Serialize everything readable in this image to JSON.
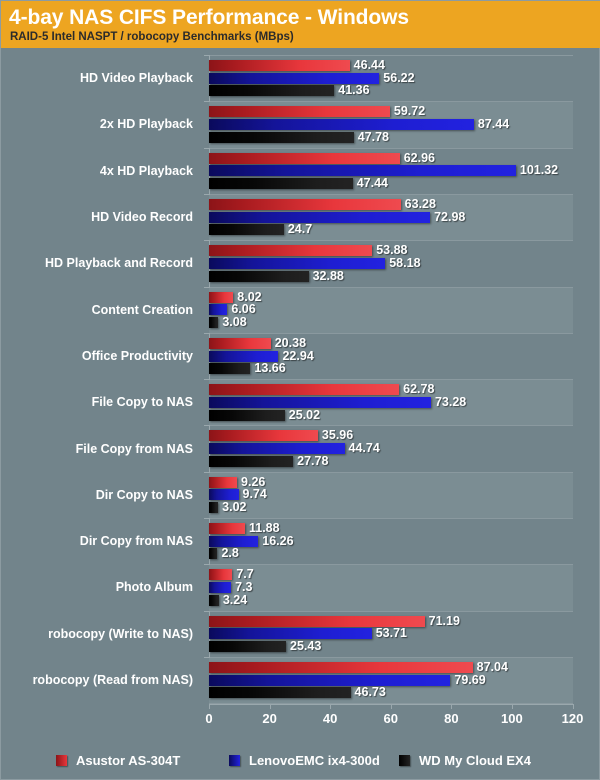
{
  "header": {
    "title": "4-bay NAS CIFS Performance - Windows",
    "subtitle": "RAID-5 Intel NASPT / robocopy Benchmarks (MBps)",
    "background_color": "#eda521",
    "title_color": "#ffffff",
    "subtitle_color": "#2b2b2b"
  },
  "canvas": {
    "background_color": "#72848b",
    "band_color": "#7b8d93"
  },
  "chart_data": {
    "type": "bar",
    "orientation": "horizontal",
    "title": "4-bay NAS CIFS Performance - Windows",
    "subtitle": "RAID-5 Intel NASPT / robocopy Benchmarks (MBps)",
    "xlabel": "",
    "ylabel": "",
    "xlim": [
      0,
      120
    ],
    "xticks": [
      0,
      20,
      40,
      60,
      80,
      100,
      120
    ],
    "grid": true,
    "legend_position": "bottom",
    "categories": [
      "HD Video Playback",
      "2x HD Playback",
      "4x HD Playback",
      "HD Video Record",
      "HD Playback and Record",
      "Content Creation",
      "Office Productivity",
      "File Copy to NAS",
      "File Copy from NAS",
      "Dir Copy to NAS",
      "Dir Copy from NAS",
      "Photo Album",
      "robocopy (Write to NAS)",
      "robocopy (Read from NAS)"
    ],
    "series": [
      {
        "name": "Asustor AS-304T",
        "color": "#d42a2f",
        "values": [
          46.44,
          59.72,
          62.96,
          63.28,
          53.88,
          8.02,
          20.38,
          62.78,
          35.96,
          9.26,
          11.88,
          7.7,
          71.19,
          87.04
        ],
        "labels": [
          "46.44",
          "59.72",
          "62.96",
          "63.28",
          "53.88",
          "8.02",
          "20.38",
          "62.78",
          "35.96",
          "9.26",
          "11.88",
          "7.7",
          "71.19",
          "87.04"
        ]
      },
      {
        "name": "LenovoEMC ix4-300d",
        "color": "#1b1bc8",
        "values": [
          56.22,
          87.44,
          101.32,
          72.98,
          58.18,
          6.06,
          22.94,
          73.28,
          44.74,
          9.74,
          16.26,
          7.3,
          53.71,
          79.69
        ],
        "labels": [
          "56.22",
          "87.44",
          "101.32",
          "72.98",
          "58.18",
          "6.06",
          "22.94",
          "73.28",
          "44.74",
          "9.74",
          "16.26",
          "7.3",
          "53.71",
          "79.69"
        ]
      },
      {
        "name": "WD My Cloud EX4",
        "color": "#111111",
        "values": [
          41.36,
          47.78,
          47.44,
          24.7,
          32.88,
          3.08,
          13.66,
          25.02,
          27.78,
          3.02,
          2.8,
          3.24,
          25.43,
          46.73
        ],
        "labels": [
          "41.36",
          "47.78",
          "47.44",
          "24.7",
          "32.88",
          "3.08",
          "13.66",
          "25.02",
          "27.78",
          "3.02",
          "2.8",
          "3.24",
          "25.43",
          "46.73"
        ]
      }
    ]
  }
}
